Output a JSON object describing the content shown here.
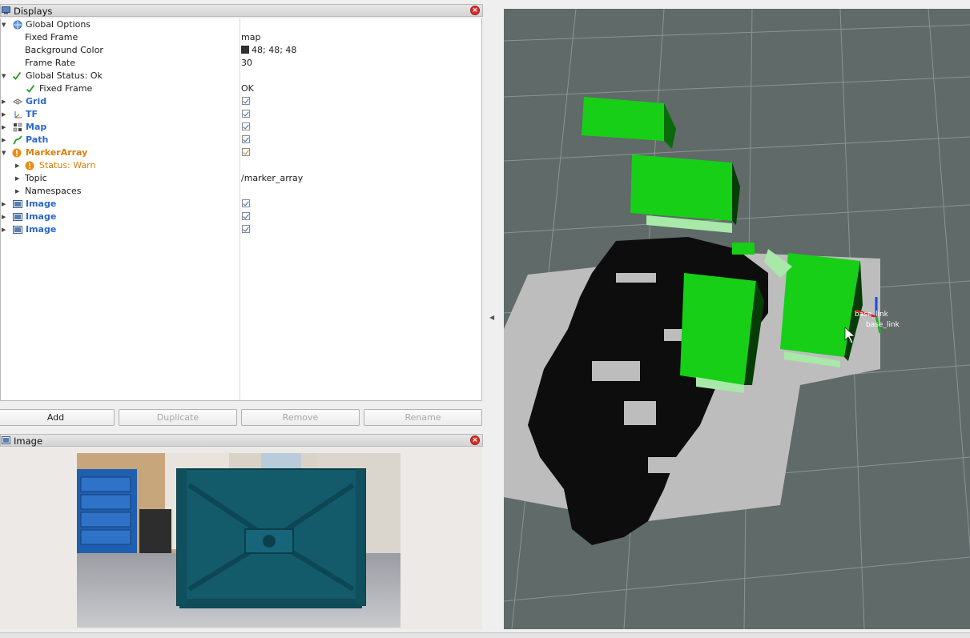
{
  "displays_panel": {
    "title": "Displays",
    "rows": [
      {
        "label": "Global Options",
        "value": ""
      },
      {
        "label": "Fixed Frame",
        "value": "map"
      },
      {
        "label": "Background Color",
        "value": "48; 48; 48"
      },
      {
        "label": "Frame Rate",
        "value": "30"
      },
      {
        "label": "Global Status: Ok",
        "value": ""
      },
      {
        "label": "Fixed Frame",
        "value": "OK"
      },
      {
        "label": "Grid",
        "value": ""
      },
      {
        "label": "TF",
        "value": ""
      },
      {
        "label": "Map",
        "value": ""
      },
      {
        "label": "Path",
        "value": ""
      },
      {
        "label": "MarkerArray",
        "value": ""
      },
      {
        "label": "Status: Warn",
        "value": ""
      },
      {
        "label": "Topic",
        "value": "/marker_array"
      },
      {
        "label": "Namespaces",
        "value": ""
      },
      {
        "label": "Image",
        "value": ""
      },
      {
        "label": "Image",
        "value": ""
      },
      {
        "label": "Image",
        "value": ""
      }
    ]
  },
  "buttons": {
    "add": "Add",
    "duplicate": "Duplicate",
    "remove": "Remove",
    "rename": "Rename"
  },
  "image_panel": {
    "title": "Image"
  },
  "viewport": {
    "tf_labels": [
      "base_link",
      "base_link"
    ]
  },
  "colors": {
    "viewport_bg": "#5f6a69",
    "marker_green": "#18cc18",
    "accent_blue": "#2a67c9",
    "warn_orange": "#d9800b"
  },
  "icons": {
    "close": "close-icon",
    "expand": "chevron-down-icon",
    "collapse": "chevron-right-icon"
  }
}
